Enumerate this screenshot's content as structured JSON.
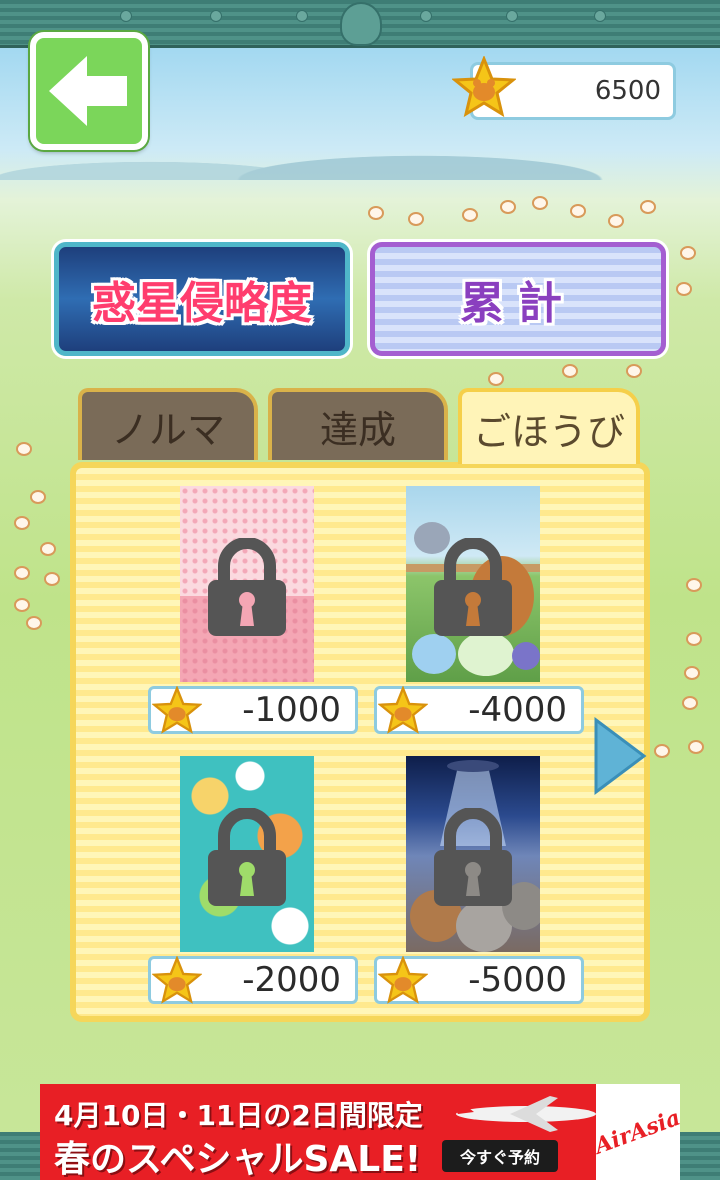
{
  "header": {
    "coin_balance": "6500"
  },
  "mode_buttons": {
    "invasion_label": "惑星侵略度",
    "total_label": "累計"
  },
  "tabs": [
    {
      "label": "ノルマ",
      "selected": false
    },
    {
      "label": "達成",
      "selected": false
    },
    {
      "label": "ごほうび",
      "selected": true
    }
  ],
  "rewards": [
    {
      "price": "-1000",
      "locked": true,
      "theme": "pink-polka"
    },
    {
      "price": "-4000",
      "locked": true,
      "theme": "hamster-farm"
    },
    {
      "price": "-2000",
      "locked": true,
      "theme": "teal-circles"
    },
    {
      "price": "-5000",
      "locked": true,
      "theme": "night-ufo"
    }
  ],
  "ad": {
    "line1": "4月10日・11日の2日間限定",
    "line2": "春のスペシャルSALE!",
    "cta": "今すぐ予約",
    "brand": "AirAsia"
  },
  "colors": {
    "back_button": "#7bd65a",
    "tab_inactive": "#7a6b58",
    "tab_active": "#fff4b8",
    "panel": "#fff6b8",
    "ad_red": "#e81f25",
    "star": "#f5c518"
  },
  "icons": {
    "back": "left-arrow-icon",
    "currency": "star-hamster-icon",
    "lock": "padlock-icon",
    "next": "right-triangle-icon"
  }
}
